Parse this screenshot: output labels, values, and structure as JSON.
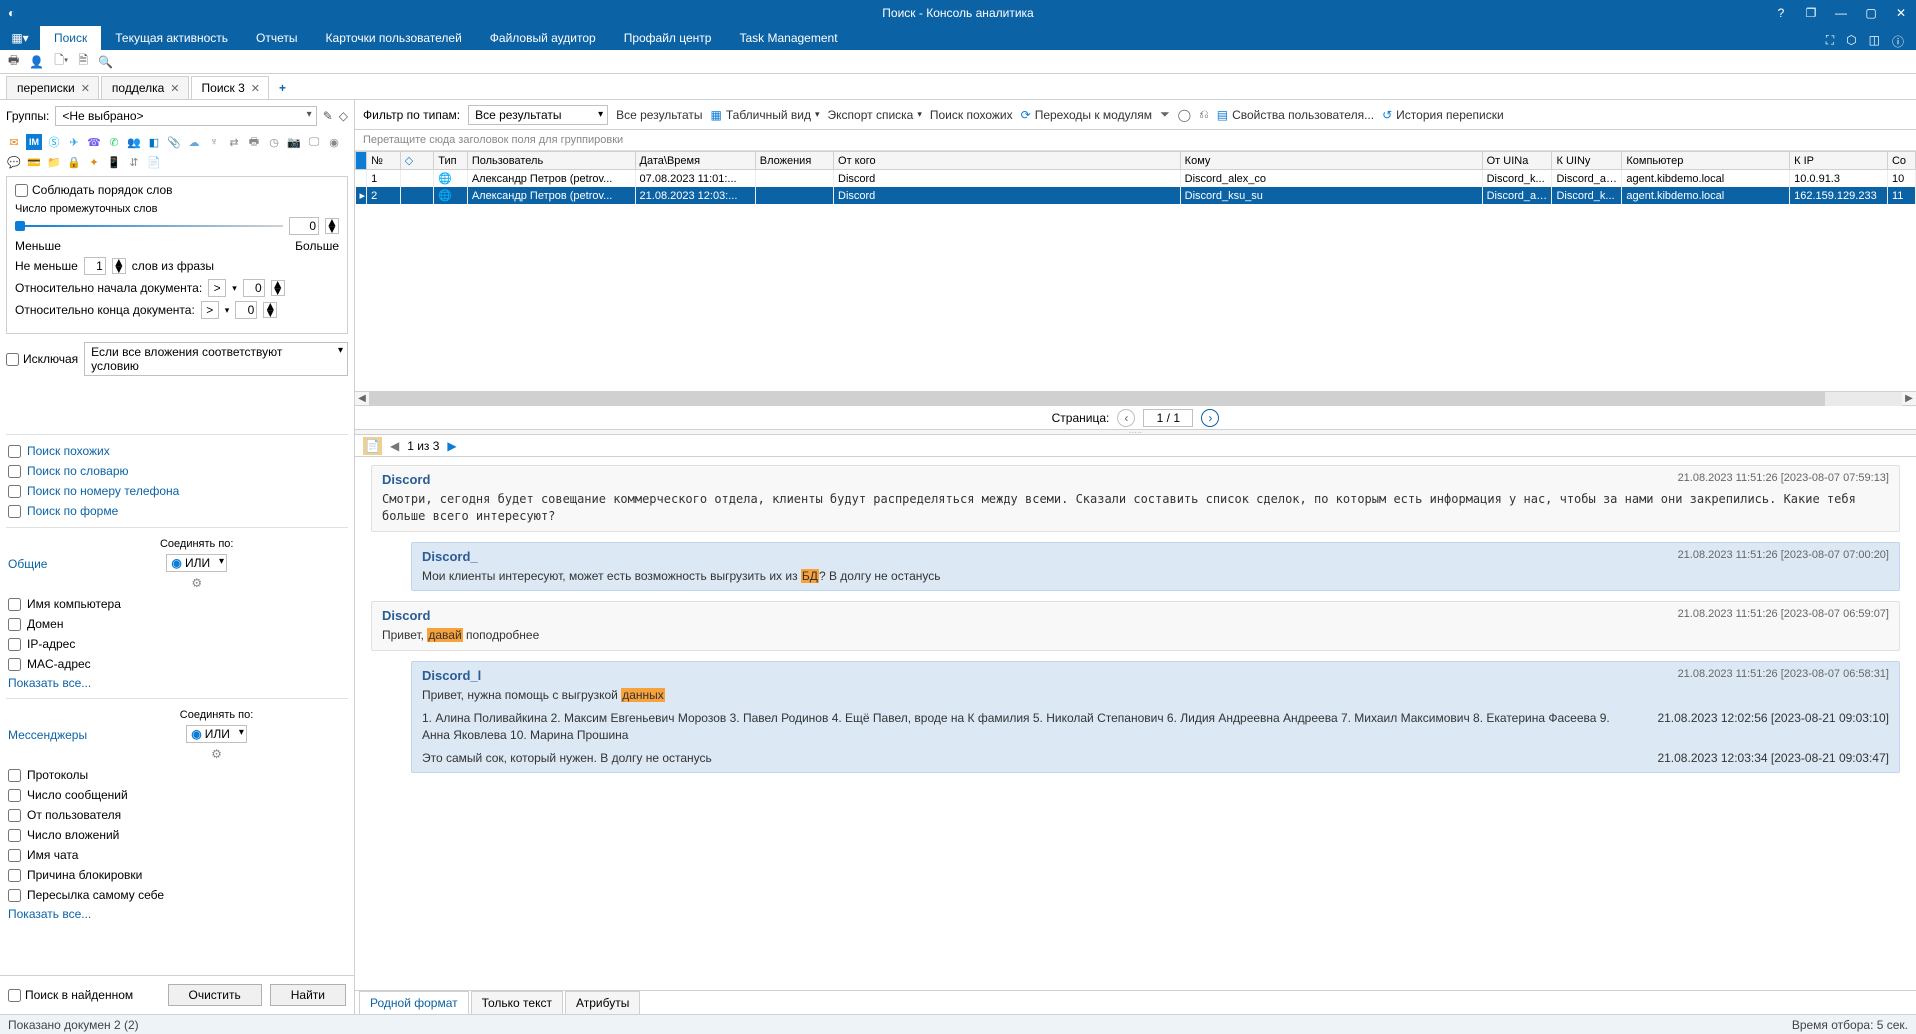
{
  "title": "Поиск - Консоль аналитика",
  "maintabs": [
    "Поиск",
    "Текущая активность",
    "Отчеты",
    "Карточки пользователей",
    "Файловый аудитор",
    "Профайл центр",
    "Task Management"
  ],
  "doctabs": [
    {
      "label": "переписки"
    },
    {
      "label": "подделка"
    },
    {
      "label": "Поиск 3",
      "active": true
    }
  ],
  "groups": {
    "label": "Группы:",
    "value": "<Не выбрано>"
  },
  "opts": {
    "keep_order": "Соблюдать порядок слов",
    "gap_words": "Число промежуточных слов",
    "less": "Меньше",
    "more": "Больше",
    "at_least": "Не меньше",
    "at_least_val": "1",
    "words_of_phrase": "слов из фразы",
    "rel_begin": "Относительно начала документа:",
    "rel_end": "Относительно конца документа:",
    "gt": ">",
    "zero": "0",
    "excluding": "Исключая",
    "attach_cond": "Если все вложения соответствуют условию"
  },
  "chk_similar": [
    "Поиск похожих",
    "Поиск по словарю",
    "Поиск по номеру телефона",
    "Поиск по форме"
  ],
  "section_general": {
    "title": "Общие",
    "join": "Соединять по:",
    "mode": "ИЛИ",
    "items": [
      "Имя компьютера",
      "Домен",
      "IP-адрес",
      "MAC-адрес"
    ],
    "show": "Показать все..."
  },
  "section_msg": {
    "title": "Мессенджеры",
    "join": "Соединять по:",
    "mode": "ИЛИ",
    "items": [
      "Протоколы",
      "Число сообщений",
      "От пользователя",
      "Число вложений",
      "Имя чата",
      "Причина блокировки",
      "Пересылка самому себе"
    ],
    "show": "Показать все..."
  },
  "left_footer": {
    "search_in_found": "Поиск в найденном",
    "clear": "Очистить",
    "find": "Найти"
  },
  "filter": {
    "label": "Фильтр по типам:",
    "all": "Все результаты",
    "all_results": "Все результаты",
    "table_view": "Табличный вид",
    "export": "Экспорт списка",
    "similar": "Поиск похожих",
    "goto": "Переходы к модулям",
    "props": "Свойства пользователя...",
    "history": "История переписки"
  },
  "group_hint": "Перетащите сюда заголовок поля для группировки",
  "grid": {
    "cols": [
      "№",
      "",
      "Тип",
      "Пользователь",
      "Дата\\Время",
      "Вложения",
      "От кого",
      "Кому",
      "От UINa",
      "К UINy",
      "Компьютер",
      "К IP",
      "Со"
    ],
    "rows": [
      {
        "num": "1",
        "user": "Александр Петров (petrov...",
        "dt": "07.08.2023 11:01:...",
        "from": "Discord",
        "to": "Discord_alex_co",
        "fuin": "Discord_k...",
        "tuin": "Discord_al...",
        "comp": "agent.kibdemo.local",
        "ip": "10.0.91.3",
        "co": "10"
      },
      {
        "num": "2",
        "sel": true,
        "user": "Александр Петров (petrov...",
        "dt": "21.08.2023 12:03:...",
        "from": "Discord",
        "to": "Discord_ksu_su",
        "fuin": "Discord_al...",
        "tuin": "Discord_k...",
        "comp": "agent.kibdemo.local",
        "ip": "162.159.129.233",
        "co": "11"
      }
    ]
  },
  "pager": {
    "label": "Страница:",
    "value": "1 / 1"
  },
  "preview_bar": {
    "pos": "1 из 3"
  },
  "messages": [
    {
      "sender": "Discord",
      "ts": "21.08.2023 11:51:26 [2023-08-07 07:59:13]",
      "text": "Смотри, сегодня будет совещание коммерческого отдела, клиенты будут распределяться между всеми. Сказали составить список сделок, по которым есть информация у нас, чтобы за нами они закрепились. Какие тебя больше всего интересуют?"
    },
    {
      "reply": true,
      "sender": "Discord_",
      "ts": "21.08.2023 11:51:26 [2023-08-07 07:00:20]",
      "pre": "Мои клиенты интересуют, может есть возможность выгрузить их из ",
      "hl": "БД",
      "post": "? В долгу не останусь"
    },
    {
      "sender": "Discord",
      "ts": "21.08.2023 11:51:26 [2023-08-07 06:59:07]",
      "pre": "Привет, ",
      "hl": "давай",
      "post": " поподробнее"
    },
    {
      "reply": true,
      "sender": "Discord_l",
      "ts": "21.08.2023 11:51:26 [2023-08-07 06:58:31]",
      "pre": "Привет, нужна помощь с выгрузкой ",
      "hl": "данных",
      "post": "",
      "lines": [
        {
          "txt": "1. Алина Поливайкина 2. Максим Евгеньевич Морозов 3. Павел Родинов 4. Ещё Павел, вроде на К фамилия 5. Николай Степанович 6. Лидия Андреевна Андреева 7. Михаил Максимович  8. Екатерина Фасеева  9. Анна Яковлева  10. Марина Прошина",
          "ts": "21.08.2023 12:02:56 [2023-08-21 09:03:10]"
        },
        {
          "txt": "Это самый сок, который нужен. В долгу не останусь",
          "ts": "21.08.2023 12:03:34 [2023-08-21 09:03:47]"
        }
      ]
    }
  ],
  "preview_tabs": [
    "Родной формат",
    "Только текст",
    "Атрибуты"
  ],
  "status": {
    "left": "Показано докумен 2 (2)",
    "right": "Время отбора: 5 сек."
  }
}
